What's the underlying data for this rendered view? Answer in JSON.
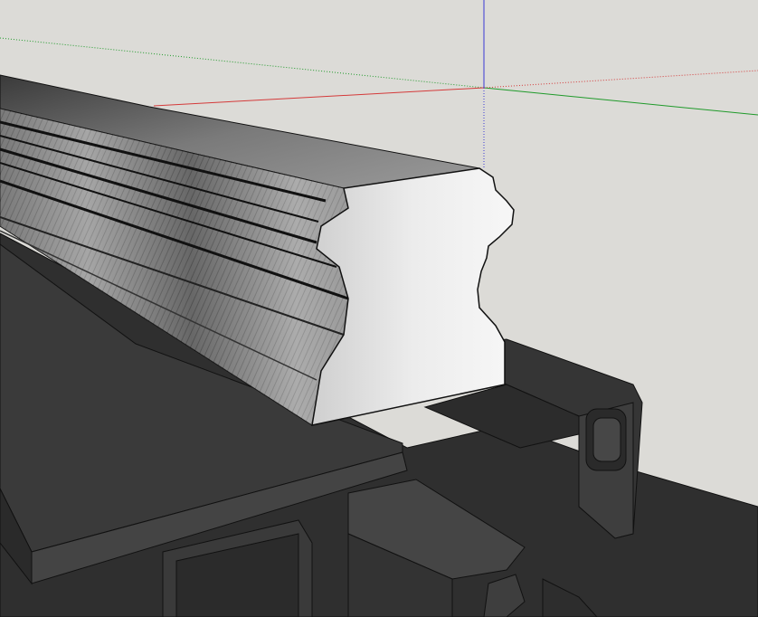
{
  "scene": {
    "colors": {
      "background": "#dcdbd7",
      "axis_red": "#d43a3a",
      "axis_green": "#1f9a2a",
      "axis_blue": "#3a3ad4",
      "extrusion_dark": "#2e2e2e",
      "extrusion_face": "#3c3c3c",
      "profile_light": "#f2f2f2",
      "profile_edge": "#111111"
    },
    "objects": [
      {
        "name": "red-axis",
        "kind": "axis"
      },
      {
        "name": "green-axis",
        "kind": "axis"
      },
      {
        "name": "blue-axis",
        "kind": "axis"
      },
      {
        "name": "moulding-profile",
        "kind": "3d-model"
      },
      {
        "name": "aluminum-extrusion",
        "kind": "3d-model"
      }
    ]
  }
}
